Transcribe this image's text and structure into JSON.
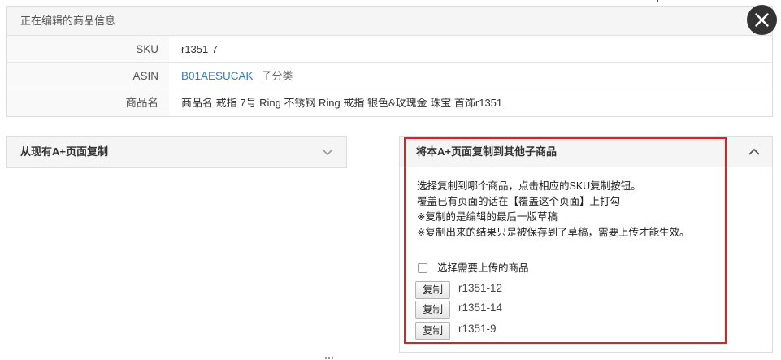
{
  "info": {
    "header": "正在编辑的商品信息",
    "sku_label": "SKU",
    "sku_value": "r1351-7",
    "asin_label": "ASIN",
    "asin_value": "B01AESUCAK",
    "asin_tag": "子分类",
    "name_label": "商品名",
    "name_value": "商品名 戒指 7号 Ring 不锈钢 Ring 戒指 银色&玫瑰金 珠宝 首饰r1351"
  },
  "copy_from": {
    "title": "从现有A+页面复制"
  },
  "copy_to": {
    "title": "将本A+页面复制到其他子商品",
    "instructions": [
      "选择复制到哪个商品，点击相应的SKU复制按钮。",
      "覆盖已有页面的话在【覆盖这个页面】上打勾",
      "※复制的是编辑的最后一版草稿",
      "※复制出来的结果只是被保存到了草稿，需要上传才能生效。"
    ],
    "select_label": "选择需要上传的商品",
    "copy_label": "复制",
    "skus": [
      "r1351-12",
      "r1351-14",
      "r1351-9"
    ]
  },
  "colors": {
    "highlight": "#e02020",
    "link": "#2f7dc2",
    "close_button": "#333333"
  },
  "icons": {
    "close": "close-icon",
    "collapse_closed": "chevron-down-icon",
    "collapse_open": "chevron-up-icon"
  }
}
